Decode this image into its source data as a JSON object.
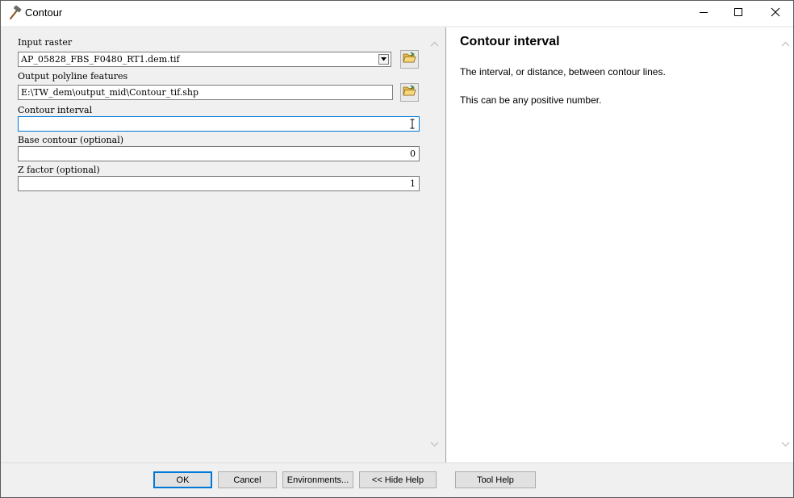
{
  "window": {
    "title": "Contour",
    "title_icon": "hammer-icon",
    "controls": [
      "minimize-icon",
      "maximize-icon",
      "close-icon"
    ]
  },
  "form": {
    "input_raster": {
      "label": "Input raster",
      "value": "AP_05828_FBS_F0480_RT1.dem.tif"
    },
    "output_features": {
      "label": "Output polyline features",
      "value": "E:\\TW_dem\\output_mid\\Contour_tif.shp"
    },
    "contour_interval": {
      "label": "Contour interval",
      "value": ""
    },
    "base_contour": {
      "label": "Base contour (optional)",
      "value": "0"
    },
    "z_factor": {
      "label": "Z factor (optional)",
      "value": "1"
    }
  },
  "help": {
    "title": "Contour interval",
    "paragraphs": [
      "The interval, or distance, between contour lines.",
      "This can be any positive number."
    ]
  },
  "buttons": {
    "ok": "OK",
    "cancel": "Cancel",
    "environments": "Environments...",
    "hide_help": "<< Hide Help",
    "tool_help": "Tool Help"
  },
  "colors": {
    "focus_border": "#0078d7",
    "dialog_bg": "#f0f0f0"
  }
}
